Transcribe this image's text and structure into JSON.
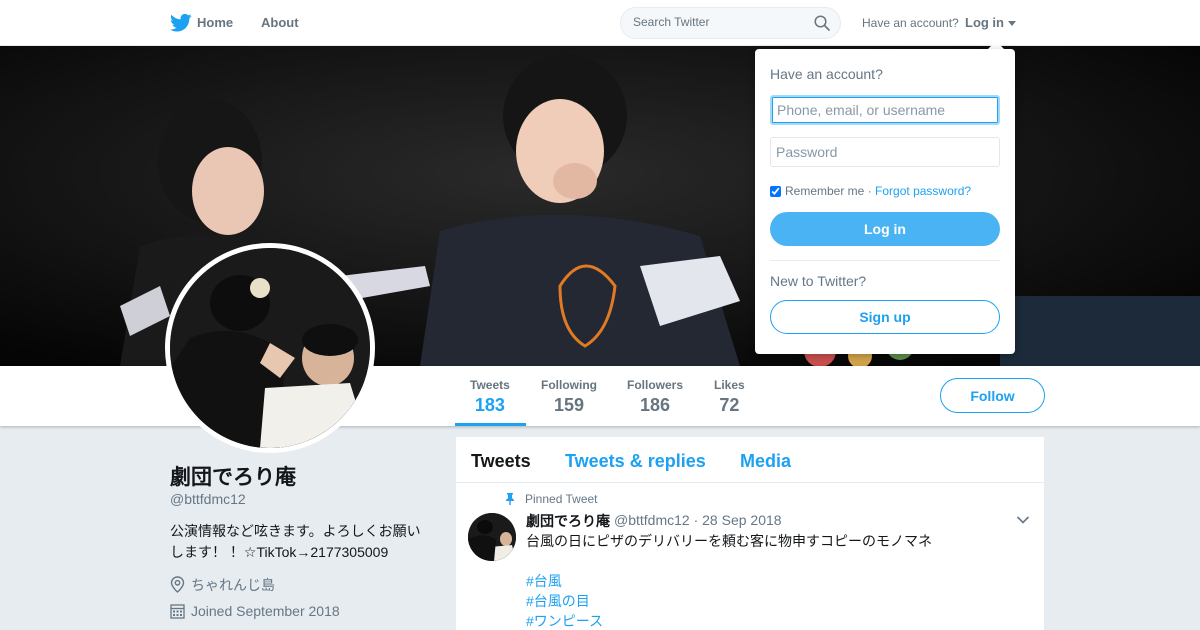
{
  "nav": {
    "home_label": "Home",
    "about_label": "About",
    "search_placeholder": "Search Twitter",
    "have_account_label": "Have an account?",
    "login_label": "Log in"
  },
  "profile": {
    "display_name": "劇団でろり庵",
    "handle": "@bttfdmc12",
    "bio": "公演情報など呟きます。よろしくお願いします！ ！☆TikTok→2177305009",
    "location": "ちゃれんじ島",
    "joined": "Joined September 2018"
  },
  "stats": [
    {
      "label": "Tweets",
      "value": "183",
      "active": true
    },
    {
      "label": "Following",
      "value": "159"
    },
    {
      "label": "Followers",
      "value": "186"
    },
    {
      "label": "Likes",
      "value": "72"
    }
  ],
  "follow_label": "Follow",
  "timeline": {
    "tabs": [
      {
        "label": "Tweets",
        "active": true
      },
      {
        "label": "Tweets & replies"
      },
      {
        "label": "Media"
      }
    ],
    "pinned_label": "Pinned Tweet",
    "tweet": {
      "author_name": "劇団でろり庵",
      "author_handle": "@bttfdmc12",
      "separator": "·",
      "date": "28 Sep 2018",
      "text": "台風の日にピザのデリバリーを頼む客に物申すコピーのモノマネ",
      "hashtags": [
        "#台風",
        "#台風の目",
        "#ワンピース"
      ]
    }
  },
  "login_dropdown": {
    "title": "Have an account?",
    "username_placeholder": "Phone, email, or username",
    "password_placeholder": "Password",
    "remember_label": "Remember me",
    "remember_checked": true,
    "separator": "·",
    "forgot_label": "Forgot password?",
    "login_button": "Log in",
    "new_label": "New to Twitter?",
    "signup_button": "Sign up"
  },
  "colors": {
    "accent": "#1da1f2",
    "login_button": "#4ab3f4",
    "background": "#e6ecf0"
  },
  "icons": {
    "logo": "twitter-bird-icon",
    "search": "search-icon",
    "location": "location-pin-icon",
    "calendar": "calendar-icon",
    "pin": "pin-icon",
    "chevron": "chevron-down-icon"
  }
}
